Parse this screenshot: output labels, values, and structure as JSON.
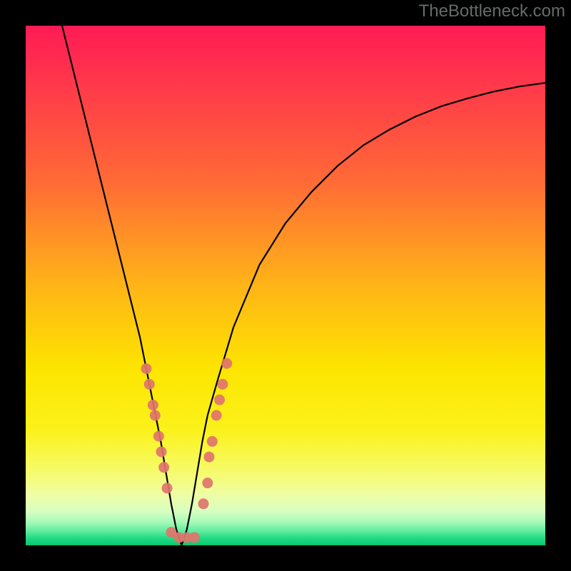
{
  "watermark": "TheBottleneck.com",
  "chart_data": {
    "type": "line",
    "title": "",
    "xlabel": "",
    "ylabel": "",
    "xlim": [
      0,
      100
    ],
    "ylim": [
      0,
      100
    ],
    "x_optimum": 30,
    "series": [
      {
        "name": "bottleneck-curve",
        "x": [
          7,
          10,
          13,
          16,
          19,
          22,
          24,
          25,
          26,
          27,
          28,
          29,
          30,
          31,
          32,
          33,
          34,
          35,
          37,
          40,
          45,
          50,
          55,
          60,
          65,
          70,
          75,
          80,
          85,
          90,
          95,
          100
        ],
        "values": [
          100,
          88,
          76,
          64,
          52,
          40,
          30,
          25,
          20,
          14,
          8,
          3,
          0,
          3,
          8,
          14,
          20,
          25,
          32,
          42,
          54,
          62,
          68,
          73,
          77,
          80,
          82.5,
          84.5,
          86,
          87.3,
          88.3,
          89
        ]
      }
    ],
    "scatter_points": {
      "name": "sample-dots",
      "points": [
        {
          "x": 23.2,
          "y": 34
        },
        {
          "x": 23.8,
          "y": 31
        },
        {
          "x": 24.5,
          "y": 27
        },
        {
          "x": 24.9,
          "y": 25
        },
        {
          "x": 25.6,
          "y": 21
        },
        {
          "x": 26.1,
          "y": 18
        },
        {
          "x": 26.6,
          "y": 15
        },
        {
          "x": 27.2,
          "y": 11
        },
        {
          "x": 28.0,
          "y": 2.5
        },
        {
          "x": 29.5,
          "y": 1.5
        },
        {
          "x": 31.0,
          "y": 1.5
        },
        {
          "x": 32.5,
          "y": 1.5
        },
        {
          "x": 34.2,
          "y": 8
        },
        {
          "x": 35.0,
          "y": 12
        },
        {
          "x": 35.3,
          "y": 17
        },
        {
          "x": 35.9,
          "y": 20
        },
        {
          "x": 36.7,
          "y": 25
        },
        {
          "x": 37.3,
          "y": 28
        },
        {
          "x": 37.9,
          "y": 31
        },
        {
          "x": 38.7,
          "y": 35
        }
      ]
    },
    "gradient_stops": [
      {
        "offset": 0.0,
        "color": "#ff1b55"
      },
      {
        "offset": 0.12,
        "color": "#ff3a4a"
      },
      {
        "offset": 0.3,
        "color": "#ff6a36"
      },
      {
        "offset": 0.5,
        "color": "#ffb417"
      },
      {
        "offset": 0.66,
        "color": "#fde500"
      },
      {
        "offset": 0.78,
        "color": "#fbf21c"
      },
      {
        "offset": 0.86,
        "color": "#f6fb6d"
      },
      {
        "offset": 0.905,
        "color": "#eefea8"
      },
      {
        "offset": 0.935,
        "color": "#d7ffc0"
      },
      {
        "offset": 0.955,
        "color": "#a7f9b9"
      },
      {
        "offset": 0.972,
        "color": "#63eda0"
      },
      {
        "offset": 0.986,
        "color": "#22db84"
      },
      {
        "offset": 1.0,
        "color": "#06c96e"
      }
    ]
  }
}
